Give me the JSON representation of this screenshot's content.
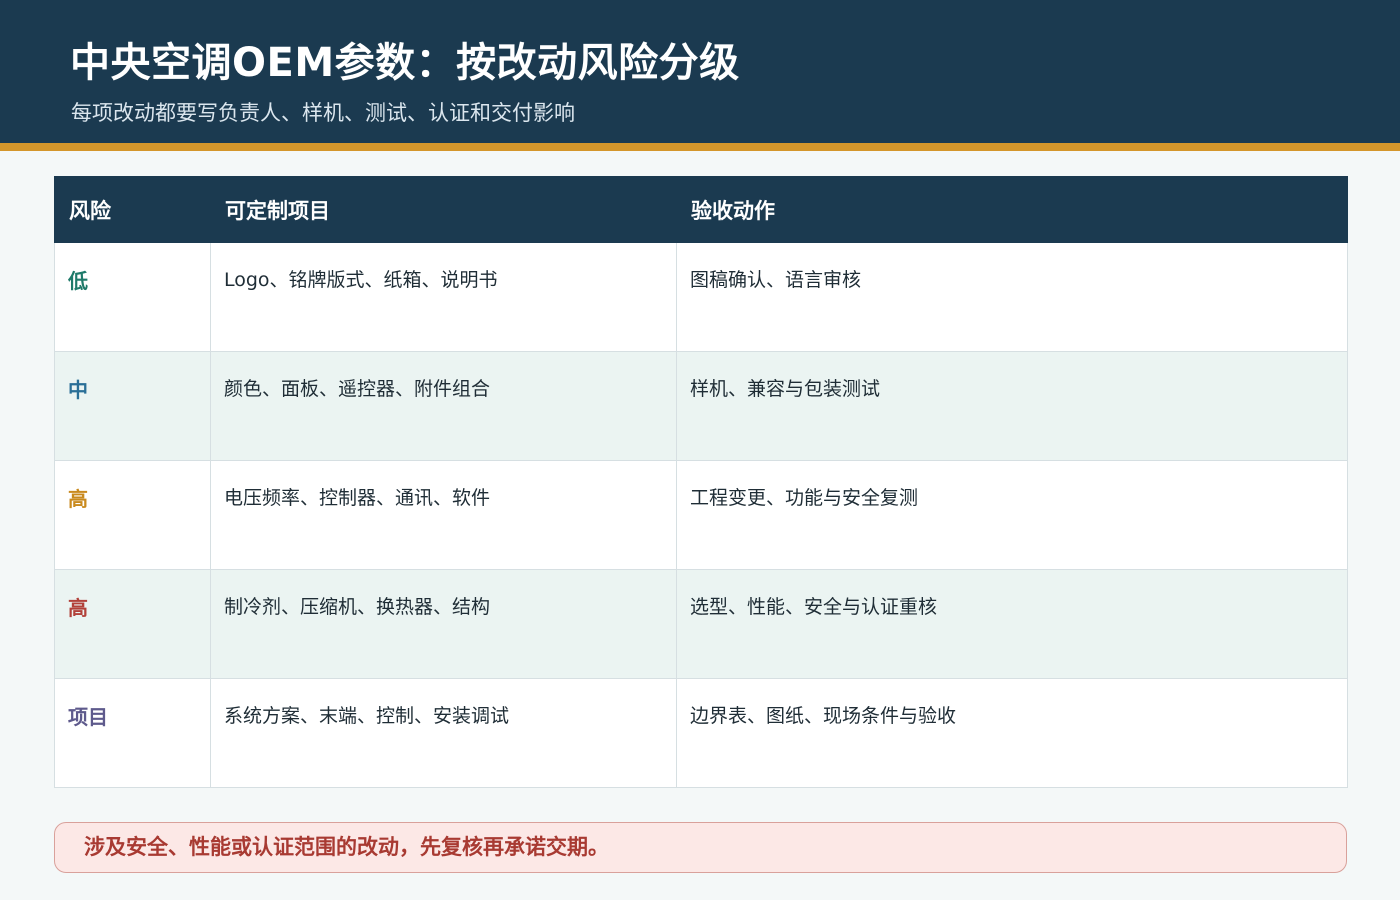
{
  "header": {
    "title": "中央空调OEM参数：按改动风险分级",
    "subtitle": "每项改动都要写负责人、样机、测试、认证和交付影响"
  },
  "table": {
    "columns": [
      "风险",
      "可定制项目",
      "验收动作"
    ],
    "rows": [
      {
        "level": "低",
        "level_color": "#1f7a6a",
        "items": "Logo、铭牌版式、纸箱、说明书",
        "action": "图稿确认、语言审核"
      },
      {
        "level": "中",
        "level_color": "#2a6f97",
        "items": "颜色、面板、遥控器、附件组合",
        "action": "样机、兼容与包装测试"
      },
      {
        "level": "高",
        "level_color": "#c98a1e",
        "items": "电压频率、控制器、通讯、软件",
        "action": "工程变更、功能与安全复测"
      },
      {
        "level": "高",
        "level_color": "#b2413a",
        "items": "制冷剂、压缩机、换热器、结构",
        "action": "选型、性能、安全与认证重核"
      },
      {
        "level": "项目",
        "level_color": "#5e5a8c",
        "items": "系统方案、末端、控制、安装调试",
        "action": "边界表、图纸、现场条件与验收"
      }
    ]
  },
  "notice": {
    "text": "涉及安全、性能或认证范围的改动，先复核再承诺交期。"
  },
  "colors": {
    "header_bg": "#1b3a50",
    "accent_rule": "#d4962b",
    "notice_bg": "#fce8e6",
    "notice_text": "#a83a32"
  }
}
